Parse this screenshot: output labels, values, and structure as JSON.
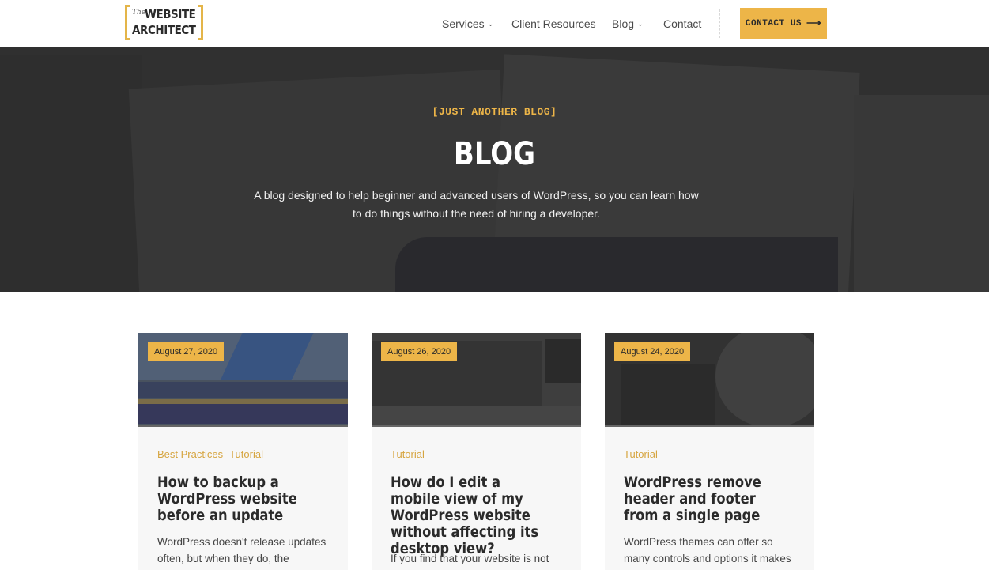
{
  "header": {
    "logo": {
      "the": "The",
      "line1": "WEBSITE",
      "line2": "ARCHITECT"
    },
    "nav": [
      {
        "label": "Services",
        "has_dropdown": true
      },
      {
        "label": "Client Resources",
        "has_dropdown": false
      },
      {
        "label": "Blog",
        "has_dropdown": true
      },
      {
        "label": "Contact",
        "has_dropdown": false
      }
    ],
    "cta_label": "CONTACT US"
  },
  "hero": {
    "kicker": "[JUST ANOTHER BLOG]",
    "title": "BLOG",
    "description": "A blog designed to help beginner and advanced users of WordPress, so you can learn how to do things without the need of hiring a developer."
  },
  "posts": [
    {
      "date": "August 27, 2020",
      "categories": [
        "Best Practices",
        "Tutorial"
      ],
      "title": "How to backup a WordPress website before an update",
      "excerpt": "WordPress doesn't release updates often, but when they do, the"
    },
    {
      "date": "August 26, 2020",
      "categories": [
        "Tutorial"
      ],
      "title": "How do I edit a mobile view of my WordPress website without affecting its desktop view?",
      "excerpt": "If you find that your website is not"
    },
    {
      "date": "August 24, 2020",
      "categories": [
        "Tutorial"
      ],
      "title": "WordPress remove header and footer from a single page",
      "excerpt": "WordPress themes can offer so many controls and options it makes"
    }
  ],
  "colors": {
    "accent": "#edb548",
    "hero_bg": "#3a3a3a",
    "category_link": "#d6a540"
  },
  "icons": {
    "dropdown": "chevron-down-icon",
    "cta_arrow": "arrow-right-icon"
  }
}
